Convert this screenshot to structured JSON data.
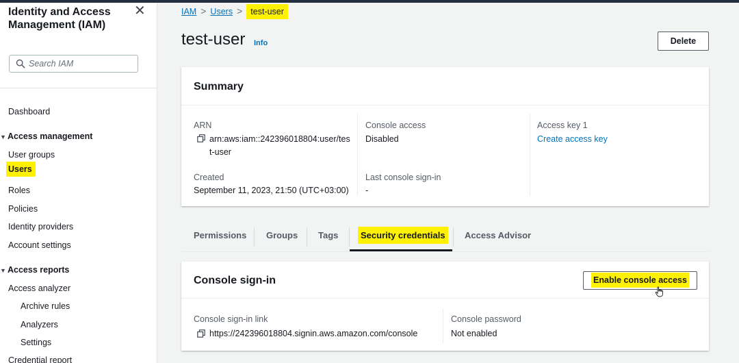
{
  "sidebar": {
    "title": "Identity and Access Management (IAM)",
    "close_icon": "close-icon",
    "search_placeholder": "Search IAM",
    "dashboard": "Dashboard",
    "access_management": {
      "label": "Access management",
      "items": [
        "User groups",
        "Users",
        "Roles",
        "Policies",
        "Identity providers",
        "Account settings"
      ],
      "active": "Users"
    },
    "access_reports": {
      "label": "Access reports",
      "analyzer": "Access analyzer",
      "sub_items": [
        "Archive rules",
        "Analyzers",
        "Settings"
      ],
      "credential_report": "Credential report"
    }
  },
  "breadcrumb": [
    "IAM",
    "Users",
    "test-user"
  ],
  "page": {
    "title": "test-user",
    "info": "Info",
    "delete_label": "Delete"
  },
  "summary": {
    "header": "Summary",
    "arn_label": "ARN",
    "arn_line1": "arn:aws:iam::242396018804:user/tes",
    "arn_line2": "t-user",
    "created_label": "Created",
    "created_value": "September 11, 2023, 21:50 (UTC+03:00)",
    "console_access_label": "Console access",
    "console_access_value": "Disabled",
    "last_signin_label": "Last console sign-in",
    "last_signin_value": "-",
    "access_key_label": "Access key 1",
    "access_key_link": "Create access key"
  },
  "tabs": [
    "Permissions",
    "Groups",
    "Tags",
    "Security credentials",
    "Access Advisor"
  ],
  "active_tab": "Security credentials",
  "console_signin": {
    "header": "Console sign-in",
    "enable_label": "Enable console access",
    "link_label": "Console sign-in link",
    "link_value": "https://242396018804.signin.aws.amazon.com/console",
    "password_label": "Console password",
    "password_value": "Not enabled"
  },
  "colors": {
    "highlight": "#fff200",
    "link": "#0073bb",
    "text": "#16191f",
    "background": "#f2f3f3"
  }
}
